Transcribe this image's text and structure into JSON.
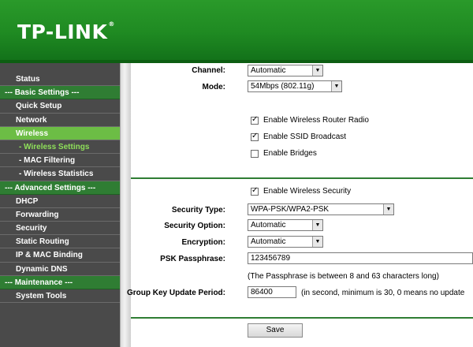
{
  "header": {
    "logo_text": "TP-LINK",
    "logo_reg": "®"
  },
  "sidebar": {
    "items": [
      {
        "label": "Status"
      },
      {
        "label": "--- Basic Settings ---"
      },
      {
        "label": "Quick Setup"
      },
      {
        "label": "Network"
      },
      {
        "label": "Wireless"
      },
      {
        "label": "- Wireless Settings"
      },
      {
        "label": "- MAC Filtering"
      },
      {
        "label": "- Wireless Statistics"
      },
      {
        "label": "--- Advanced Settings ---"
      },
      {
        "label": "DHCP"
      },
      {
        "label": "Forwarding"
      },
      {
        "label": "Security"
      },
      {
        "label": "Static Routing"
      },
      {
        "label": "IP & MAC Binding"
      },
      {
        "label": "Dynamic DNS"
      },
      {
        "label": "--- Maintenance ---"
      },
      {
        "label": "System Tools"
      }
    ]
  },
  "form": {
    "channel": {
      "label": "Channel:",
      "value": "Automatic"
    },
    "mode": {
      "label": "Mode:",
      "value": "54Mbps (802.11g)"
    },
    "enable_radio": {
      "label": "Enable Wireless Router Radio",
      "checked": true
    },
    "enable_ssid": {
      "label": "Enable SSID Broadcast",
      "checked": true
    },
    "enable_bridges": {
      "label": "Enable Bridges",
      "checked": false
    },
    "enable_security": {
      "label": "Enable Wireless Security",
      "checked": true
    },
    "security_type": {
      "label": "Security Type:",
      "value": "WPA-PSK/WPA2-PSK"
    },
    "security_option": {
      "label": "Security Option:",
      "value": "Automatic"
    },
    "encryption": {
      "label": "Encryption:",
      "value": "Automatic"
    },
    "psk_passphrase": {
      "label": "PSK Passphrase:",
      "value": "123456789"
    },
    "psk_note": "(The Passphrase is between 8 and 63 characters long)",
    "group_key": {
      "label": "Group Key Update Period:",
      "value": "86400",
      "note": "(in second, minimum is 30, 0 means no update"
    },
    "save_label": "Save"
  },
  "colors": {
    "header_green": "#1f8a22",
    "sidebar_bg": "#4a4a4a",
    "section_green": "#2f7d33",
    "active_green": "#6cbd45"
  }
}
